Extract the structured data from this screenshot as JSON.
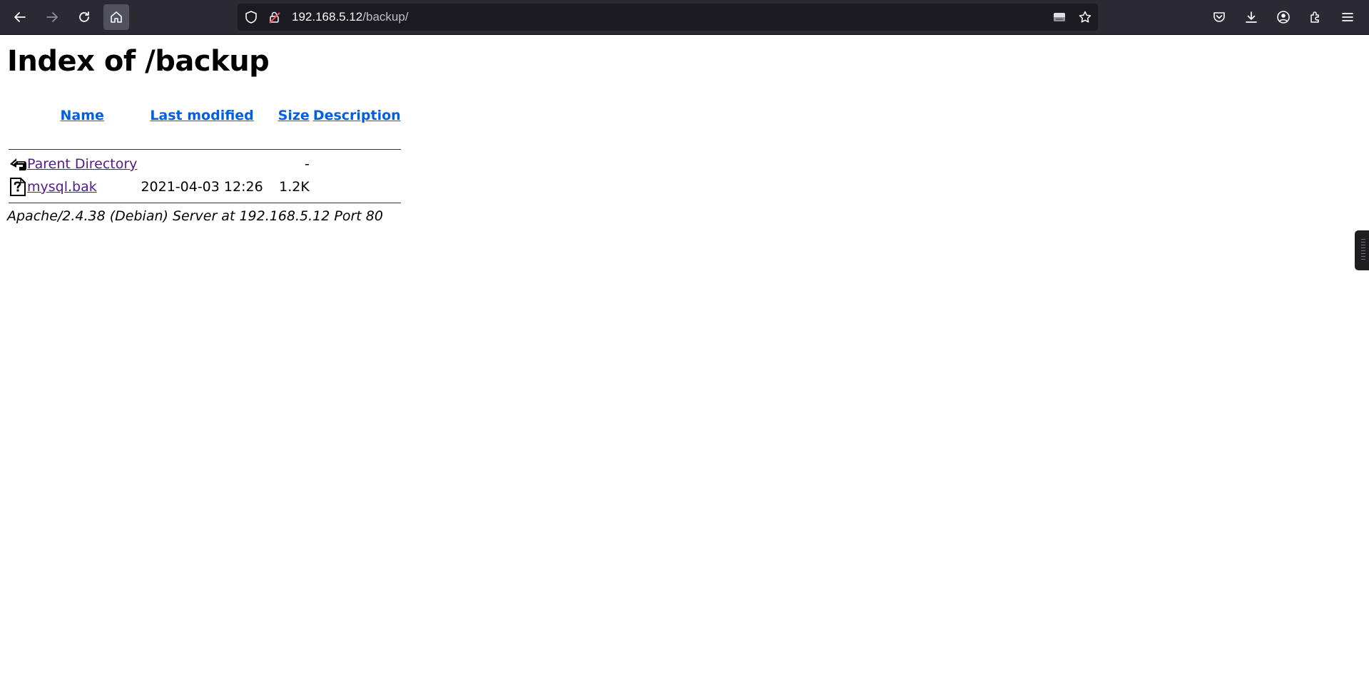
{
  "browser": {
    "url_host": "192.168.5.12",
    "url_path": "/backup/",
    "icons": [
      "back-icon",
      "forward-icon",
      "reload-icon",
      "home-icon",
      "shield-icon",
      "lock-warning-icon",
      "reader-icon",
      "star-icon",
      "pocket-icon",
      "download-icon",
      "account-icon",
      "extensions-icon",
      "menu-icon"
    ]
  },
  "page": {
    "title": "Index of /backup",
    "columns": {
      "name": "Name",
      "last_modified": "Last modified",
      "size": "Size",
      "description": "Description"
    },
    "rows": [
      {
        "icon": "back-arrow-icon",
        "name": "Parent Directory",
        "last_modified": "",
        "size": "-",
        "description": ""
      },
      {
        "icon": "unknown-file-icon",
        "name": "mysql.bak",
        "last_modified": "2021-04-03 12:26",
        "size": "1.2K",
        "description": ""
      }
    ],
    "footer": "Apache/2.4.38 (Debian) Server at 192.168.5.12 Port 80"
  },
  "colors": {
    "toolbar_bg": "#2b2a33",
    "urlbar_bg": "#1c1b22",
    "link_header": "#0060df",
    "link_visited": "#551a8b"
  }
}
